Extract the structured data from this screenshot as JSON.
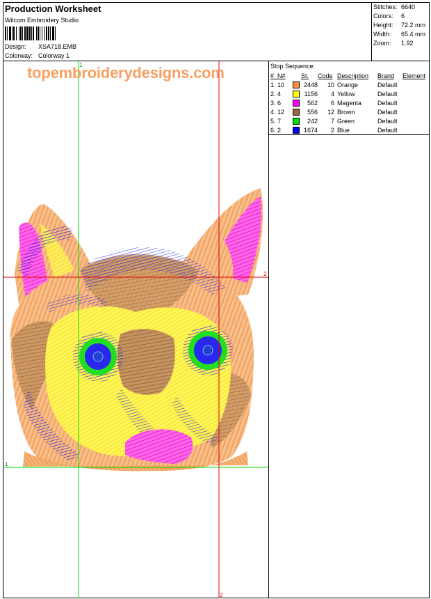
{
  "header": {
    "title": "Production Worksheet",
    "software": "Wilcom Embroidery Studio",
    "design_label": "Design:",
    "design_value": "XSA718.EMB",
    "colorway_label": "Colorway:",
    "colorway_value": "Colorway 1"
  },
  "stats": {
    "stitches_label": "Stitches:",
    "stitches_value": "6640",
    "colors_label": "Colors:",
    "colors_value": "6",
    "height_label": "Height:",
    "height_value": "72.2 mm",
    "width_label": "Width:",
    "width_value": "65.4 mm",
    "zoom_label": "Zoom:",
    "zoom_value": "1.92"
  },
  "preview": {
    "watermark": "topembroiderydesigns.com",
    "marker_green_1a": "1",
    "marker_green_1b": "1",
    "marker_red_2a": "2",
    "marker_red_2b": "2"
  },
  "stop_sequence": {
    "title": "Stop Sequence:",
    "headers": [
      "#",
      "N#",
      "St.",
      "Code",
      "Description",
      "Brand",
      "Element"
    ],
    "rows": [
      {
        "num": "1. 10",
        "color": "#ff8c3c",
        "st": "2448",
        "code": "10",
        "desc": "Orange",
        "brand": "Default"
      },
      {
        "num": "2. 4",
        "color": "#ffff00",
        "st": "1156",
        "code": "4",
        "desc": "Yellow",
        "brand": "Default"
      },
      {
        "num": "3. 6",
        "color": "#ff00ff",
        "st": "562",
        "code": "6",
        "desc": "Magenta",
        "brand": "Default"
      },
      {
        "num": "4. 12",
        "color": "#9c6a3a",
        "st": "556",
        "code": "12",
        "desc": "Brown",
        "brand": "Default"
      },
      {
        "num": "5. 7",
        "color": "#00e000",
        "st": "242",
        "code": "7",
        "desc": "Green",
        "brand": "Default"
      },
      {
        "num": "6. 2",
        "color": "#0000ff",
        "st": "1674",
        "code": "2",
        "desc": "Blue",
        "brand": "Default"
      }
    ]
  }
}
